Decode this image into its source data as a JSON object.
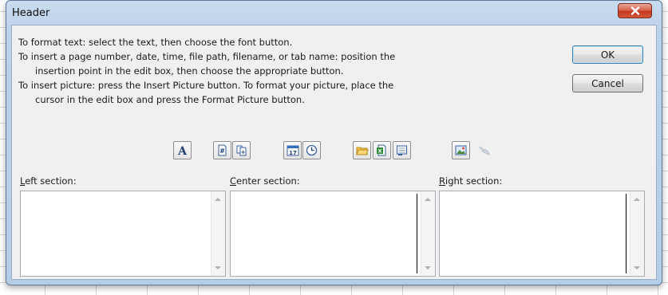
{
  "dialog": {
    "title": "Header",
    "close_icon": "close-x-icon"
  },
  "instructions": [
    "To format text:  select the text, then choose the font button.",
    "To insert a page number, date, time, file path, filename, or tab name:  position the",
    "insertion point in the edit box, then choose the appropriate button.",
    "To insert picture: press the Insert Picture button.  To format your picture, place the",
    "cursor in the edit box and press the Format Picture button."
  ],
  "buttons": {
    "ok": "OK",
    "cancel": "Cancel"
  },
  "toolbar": [
    {
      "name": "format-text-button",
      "icon": "font-A-icon"
    },
    {
      "name": "insert-page-number-button",
      "icon": "page-number-icon"
    },
    {
      "name": "insert-number-of-pages-button",
      "icon": "number-of-pages-icon"
    },
    {
      "name": "insert-date-button",
      "icon": "calendar-icon"
    },
    {
      "name": "insert-time-button",
      "icon": "clock-icon"
    },
    {
      "name": "insert-file-path-button",
      "icon": "folder-icon"
    },
    {
      "name": "insert-file-name-button",
      "icon": "excel-file-icon"
    },
    {
      "name": "insert-sheet-name-button",
      "icon": "sheet-tab-icon"
    },
    {
      "name": "insert-picture-button",
      "icon": "picture-icon"
    },
    {
      "name": "format-picture-button",
      "icon": "format-picture-icon",
      "disabled": true
    }
  ],
  "sections": {
    "left": {
      "accel": "L",
      "rest": "eft section:",
      "value": ""
    },
    "center": {
      "accel": "C",
      "rest": "enter section:",
      "value": ""
    },
    "right": {
      "accel": "R",
      "rest": "ight section:",
      "value": ""
    }
  },
  "colors": {
    "frame": "#b9cfe8",
    "close_button": "#c94a2e",
    "client_bg": "#f0f0f0"
  }
}
